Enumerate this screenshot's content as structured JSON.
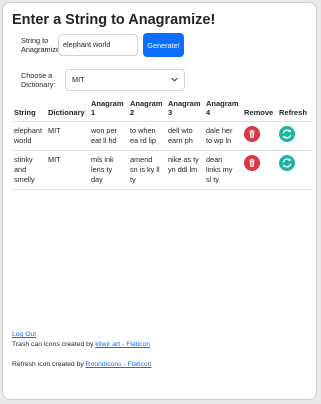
{
  "title": "Enter a String to Anagramize!",
  "form": {
    "string_label": "String to Anagramize:",
    "string_value": "elephant world",
    "generate_label": "Generate!",
    "dict_label": "Choose a Dictionary:",
    "dict_value": "MIT"
  },
  "table": {
    "headers": [
      "String",
      "Dictionary",
      "Anagram 1",
      "Anagram 2",
      "Anagram 3",
      "Anagram 4",
      "Remove",
      "Refresh"
    ],
    "rows": [
      {
        "string": "elephant world",
        "dictionary": "MIT",
        "a1": "won per eat ll hd",
        "a2": "to when ea rd lip",
        "a3": "dell wto earn ph",
        "a4": "dale her to wp ln"
      },
      {
        "string": "stinky and smelly",
        "dictionary": "MIT",
        "a1": "mls ink lens ty day",
        "a2": "amend sn is ky ll ty",
        "a3": "nike as ty yn ddl lm",
        "a4": "dean links my sl ty"
      }
    ]
  },
  "icons": {
    "remove": "trash-icon",
    "refresh": "refresh-icon"
  },
  "colors": {
    "primary": "#0d6efd",
    "remove": "#dc3545",
    "refresh": "#1fb5a1"
  },
  "footer": {
    "logout": "Log Out",
    "trash_credit_prefix": "Trash can icons created by ",
    "trash_credit_link": "kliwir art - Flaticon",
    "refresh_credit_prefix": "Refresh icon created by ",
    "refresh_credit_link": "Roundicons - Flaticon"
  }
}
